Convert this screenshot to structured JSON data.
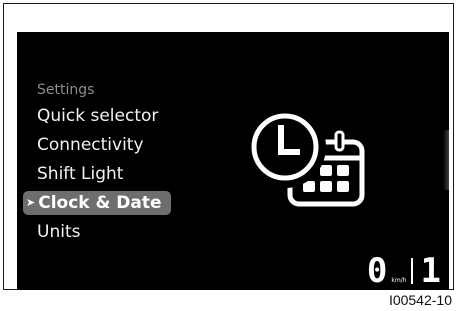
{
  "menu": {
    "header": "Settings",
    "items": [
      {
        "label": "Quick selector",
        "selected": false
      },
      {
        "label": "Connectivity",
        "selected": false
      },
      {
        "label": "Shift Light",
        "selected": false
      },
      {
        "label": "Clock & Date",
        "selected": true
      },
      {
        "label": "Units",
        "selected": false
      }
    ],
    "selection_marker_icon": "diamond-arrow-icon"
  },
  "preview": {
    "icon": "clock-calendar-icon"
  },
  "status": {
    "speed": "0",
    "speed_unit": "km/h",
    "gear": "1"
  },
  "figure_id": "I00542-10",
  "colors": {
    "screen_background": "#000000",
    "menu_text": "#f2f2f2",
    "menu_header_text": "#8e8e8e",
    "selection_background": "#6e6e6e",
    "icon_stroke": "#ffffff"
  }
}
